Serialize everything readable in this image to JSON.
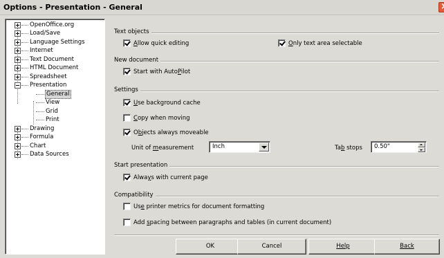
{
  "window": {
    "title": "Options - Presentation - General"
  },
  "tree": {
    "items": [
      {
        "label": "OpenOffice.org",
        "expander": "plus"
      },
      {
        "label": "Load/Save",
        "expander": "plus"
      },
      {
        "label": "Language Settings",
        "expander": "plus"
      },
      {
        "label": "Internet",
        "expander": "plus"
      },
      {
        "label": "Text Document",
        "expander": "plus"
      },
      {
        "label": "HTML Document",
        "expander": "plus"
      },
      {
        "label": "Spreadsheet",
        "expander": "plus"
      },
      {
        "label": "Presentation",
        "expander": "minus"
      },
      {
        "label": "Drawing",
        "expander": "plus"
      },
      {
        "label": "Formula",
        "expander": "plus"
      },
      {
        "label": "Chart",
        "expander": "plus"
      },
      {
        "label": "Data Sources",
        "expander": "plus"
      }
    ],
    "presentation_children": [
      "General",
      "View",
      "Grid",
      "Print"
    ],
    "selected": "General"
  },
  "text_objects": {
    "title": "Text objects",
    "allow_quick_editing": {
      "pre": "",
      "ul": "A",
      "post": "llow quick editing",
      "checked": true
    },
    "only_text_area": {
      "pre": "",
      "ul": "O",
      "post": "nly text area selectable",
      "checked": true
    }
  },
  "new_document": {
    "title": "New document",
    "start_with_autopilot": {
      "pre": "Start with Auto",
      "ul": "P",
      "post": "ilot",
      "checked": true
    }
  },
  "settings": {
    "title": "Settings",
    "use_background_cache": {
      "pre": "",
      "ul": "U",
      "post": "se background cache",
      "checked": true
    },
    "copy_when_moving": {
      "pre": "",
      "ul": "C",
      "post": "opy when moving",
      "checked": false
    },
    "objects_always_moveable": {
      "pre": "O",
      "ul": "b",
      "post": "jects always moveable",
      "checked": true
    },
    "unit_label": {
      "pre": "Unit of ",
      "ul": "m",
      "post": "easurement"
    },
    "unit_value": "Inch",
    "tab_stops_label": {
      "pre": "Ta",
      "ul": "b",
      "post": " stops"
    },
    "tab_stops_value": "0.50\""
  },
  "start_presentation": {
    "title": "Start presentation",
    "always_with_current_page": {
      "pre": "Alwa",
      "ul": "y",
      "post": "s with current page",
      "checked": true
    }
  },
  "compatibility": {
    "title": "Compatibility",
    "printer_metrics": {
      "pre": "Us",
      "ul": "e",
      "post": " printer metrics for document formatting",
      "checked": false
    },
    "add_spacing": {
      "pre": "Add ",
      "ul": "s",
      "post": "pacing between paragraphs and tables (in current document)",
      "checked": false
    }
  },
  "buttons": {
    "ok": "OK",
    "cancel": "Cancel",
    "help": "Help",
    "back": "Back"
  }
}
